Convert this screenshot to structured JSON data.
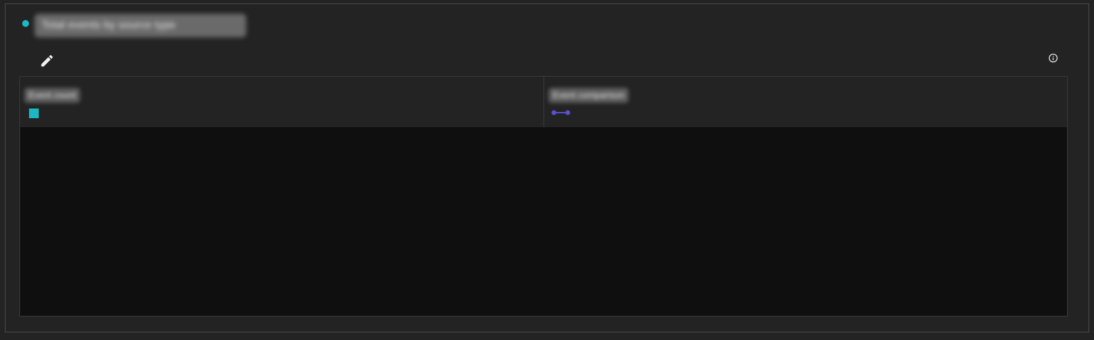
{
  "card": {
    "title": "Total events by source type",
    "status_color": "#1bb8c4"
  },
  "toolbar": {
    "edit_icon": "pencil-icon",
    "info_icon": "info-circle-icon"
  },
  "legend": {
    "items": [
      {
        "label": "Event count",
        "marker": "square",
        "color": "#1bb8c4"
      },
      {
        "label": "Event comparison",
        "marker": "line",
        "color": "#5a4fd0"
      }
    ]
  }
}
